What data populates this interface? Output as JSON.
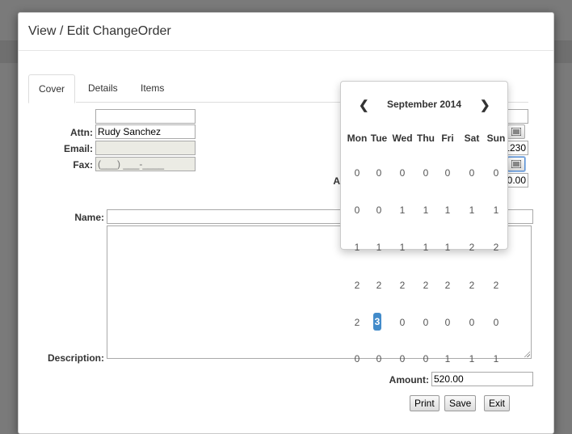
{
  "dialog": {
    "title": "View / Edit ChangeOrder"
  },
  "tabs": [
    {
      "label": "Cover",
      "active": true
    },
    {
      "label": "Details",
      "active": false
    },
    {
      "label": "Items",
      "active": false
    }
  ],
  "form": {
    "attn_label": "Attn:",
    "attn_value": "Rudy Sanchez",
    "email_label": "Email:",
    "email_value": "",
    "fax_label": "Fax:",
    "fax_placeholder": "(___) ___-____",
    "right_partial_1": "1230",
    "right_partial_2": "0.00",
    "right_label_partial": "A",
    "name_label": "Name:",
    "name_value": "",
    "description_label": "Description:",
    "description_value": "",
    "amount_label": "Amount:",
    "amount_value": "520.00"
  },
  "buttons": {
    "print": "Print",
    "save": "Save",
    "exit": "Exit"
  },
  "datepicker": {
    "month_label": "September 2014",
    "prev_glyph": "❮",
    "next_glyph": "❯",
    "weekdays": [
      "Mon",
      "Tue",
      "Wed",
      "Thu",
      "Fri",
      "Sat",
      "Sun"
    ],
    "rows": [
      [
        "0",
        "0",
        "0",
        "0",
        "0",
        "0",
        "0"
      ],
      [
        "0",
        "0",
        "1",
        "1",
        "1",
        "1",
        "1"
      ],
      [
        "1",
        "1",
        "1",
        "1",
        "1",
        "2",
        "2"
      ],
      [
        "2",
        "2",
        "2",
        "2",
        "2",
        "2",
        "2"
      ],
      [
        "2",
        "3",
        "0",
        "0",
        "0",
        "0",
        "0"
      ],
      [
        "0",
        "0",
        "0",
        "0",
        "1",
        "1",
        "1"
      ]
    ],
    "selected": "3"
  },
  "colors": {
    "accent": "#428bca",
    "backdrop": "#7a7a7a"
  }
}
